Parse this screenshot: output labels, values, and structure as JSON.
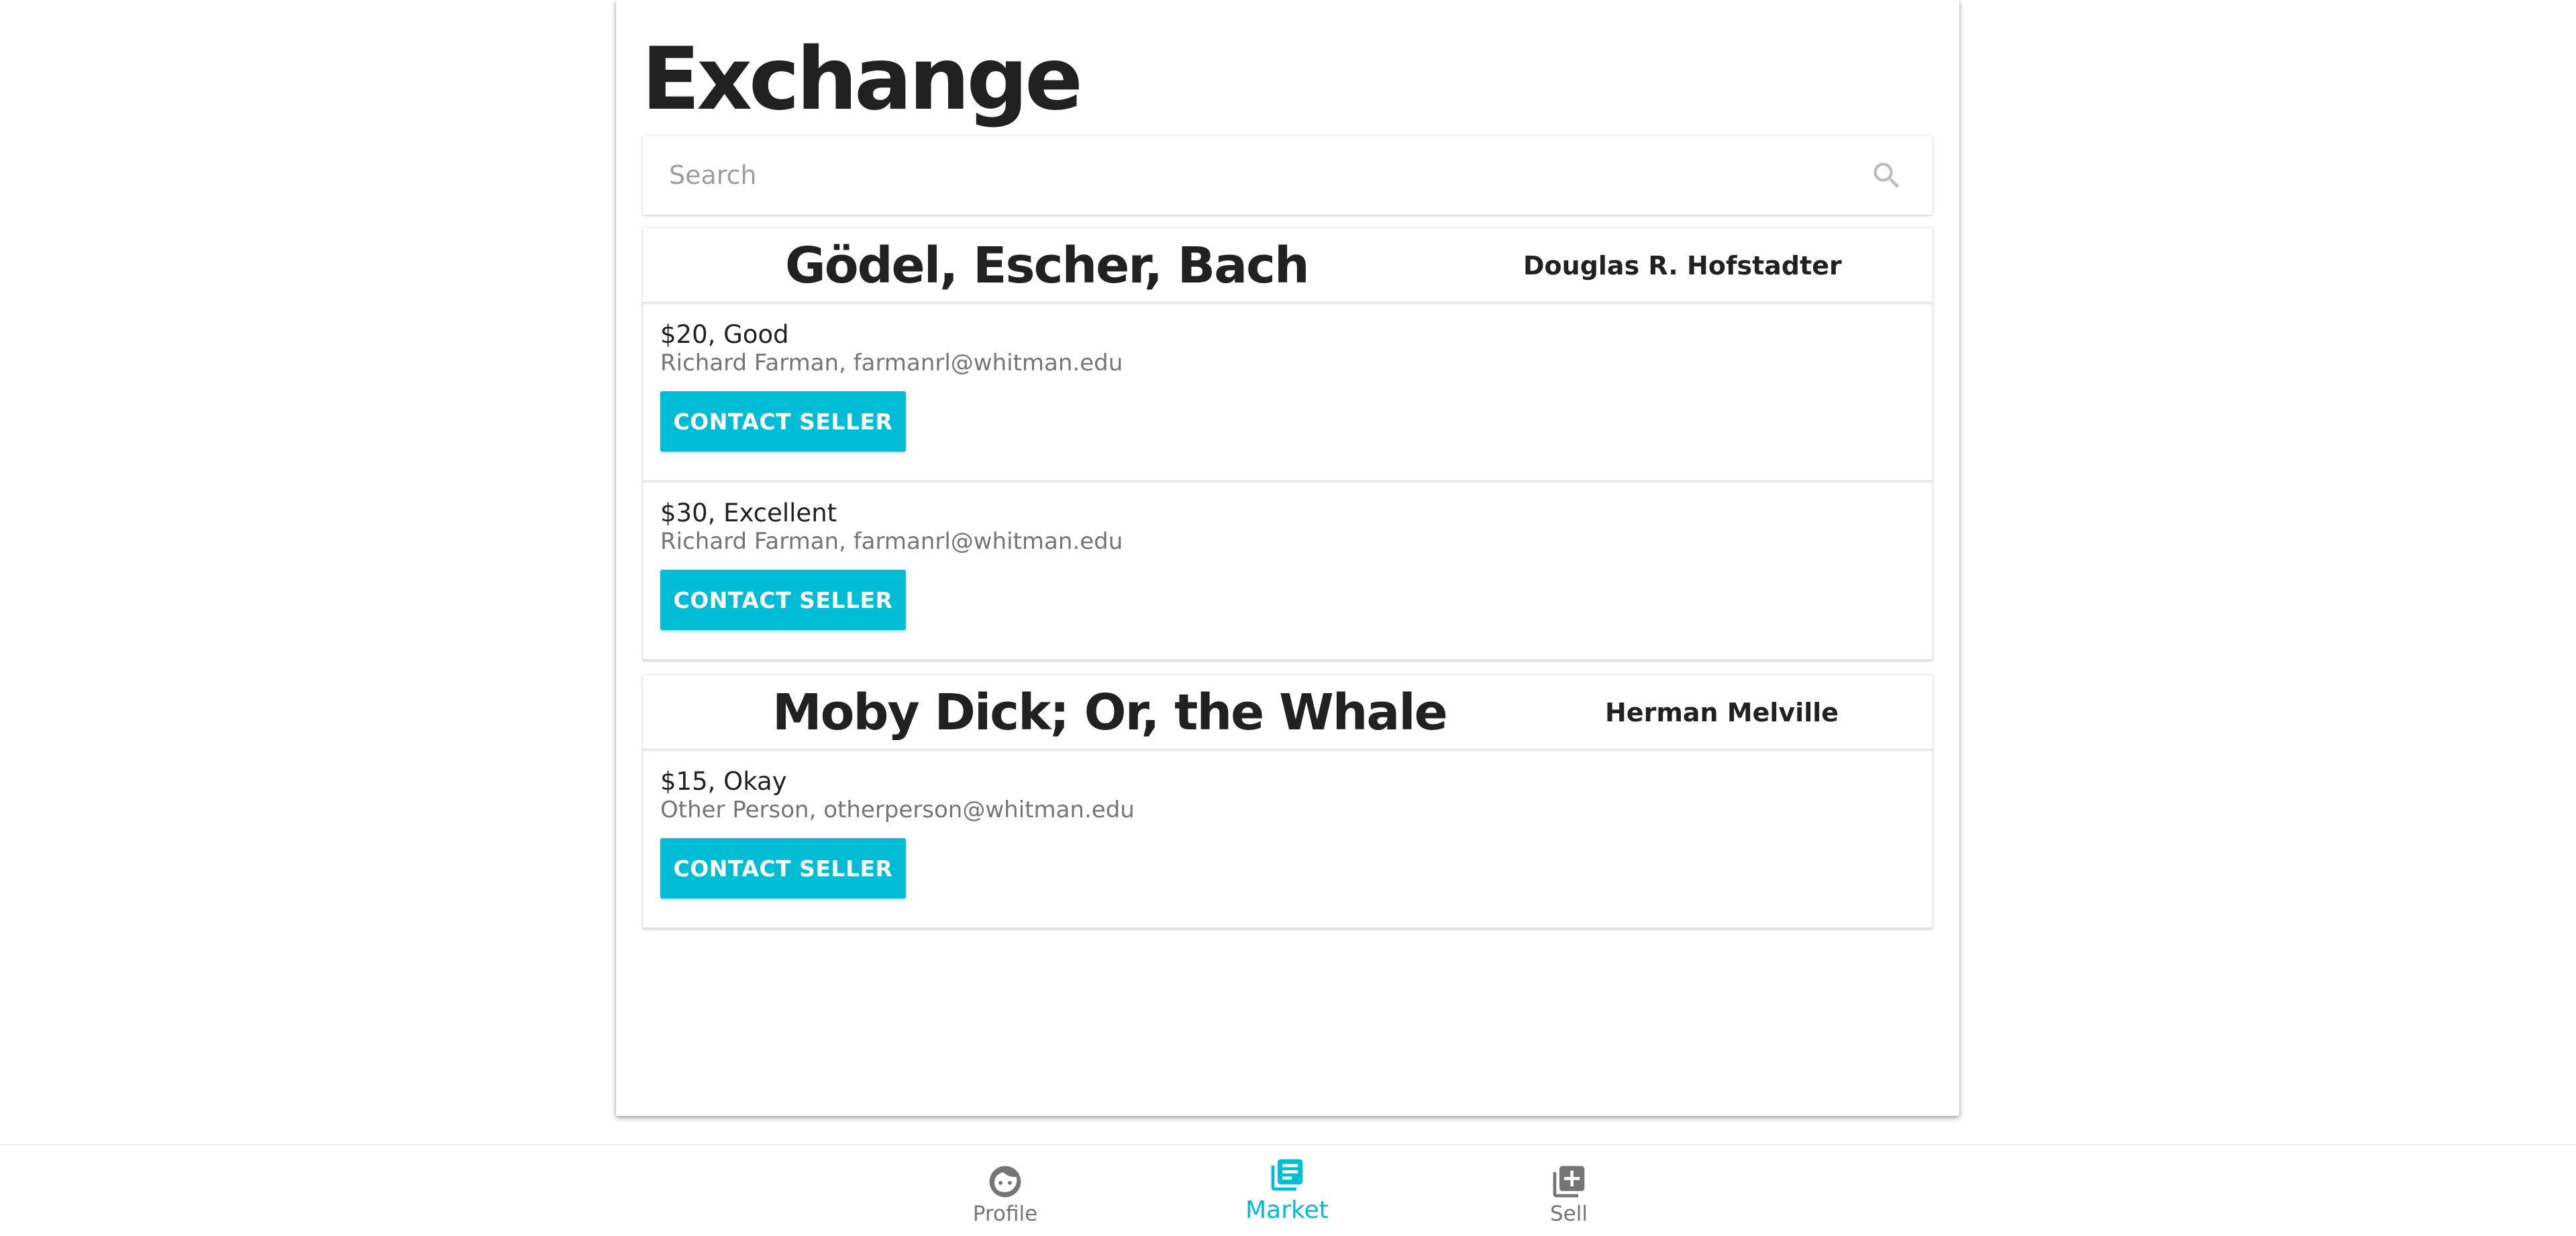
{
  "page": {
    "title": "Exchange"
  },
  "search": {
    "placeholder": "Search",
    "value": ""
  },
  "books": [
    {
      "title": "Gödel, Escher, Bach",
      "author": "Douglas R. Hofstadter",
      "listings": [
        {
          "price_condition": "$20, Good",
          "seller": "Richard Farman, farmanrl@whitman.edu",
          "button_label": "CONTACT SELLER"
        },
        {
          "price_condition": "$30, Excellent",
          "seller": "Richard Farman, farmanrl@whitman.edu",
          "button_label": "CONTACT SELLER"
        }
      ]
    },
    {
      "title": "Moby Dick; Or, the Whale",
      "author": "Herman Melville",
      "listings": [
        {
          "price_condition": "$15, Okay",
          "seller": "Other Person, otherperson@whitman.edu",
          "button_label": "CONTACT SELLER"
        }
      ]
    }
  ],
  "bottom_nav": {
    "items": [
      {
        "label": "Profile",
        "icon": "face-icon",
        "active": false
      },
      {
        "label": "Market",
        "icon": "library-books-icon",
        "active": true
      },
      {
        "label": "Sell",
        "icon": "library-add-icon",
        "active": false
      }
    ]
  },
  "colors": {
    "accent": "#00bcd4",
    "text_primary": "#212121",
    "text_secondary": "#757575",
    "nav_inactive": "#757575"
  }
}
